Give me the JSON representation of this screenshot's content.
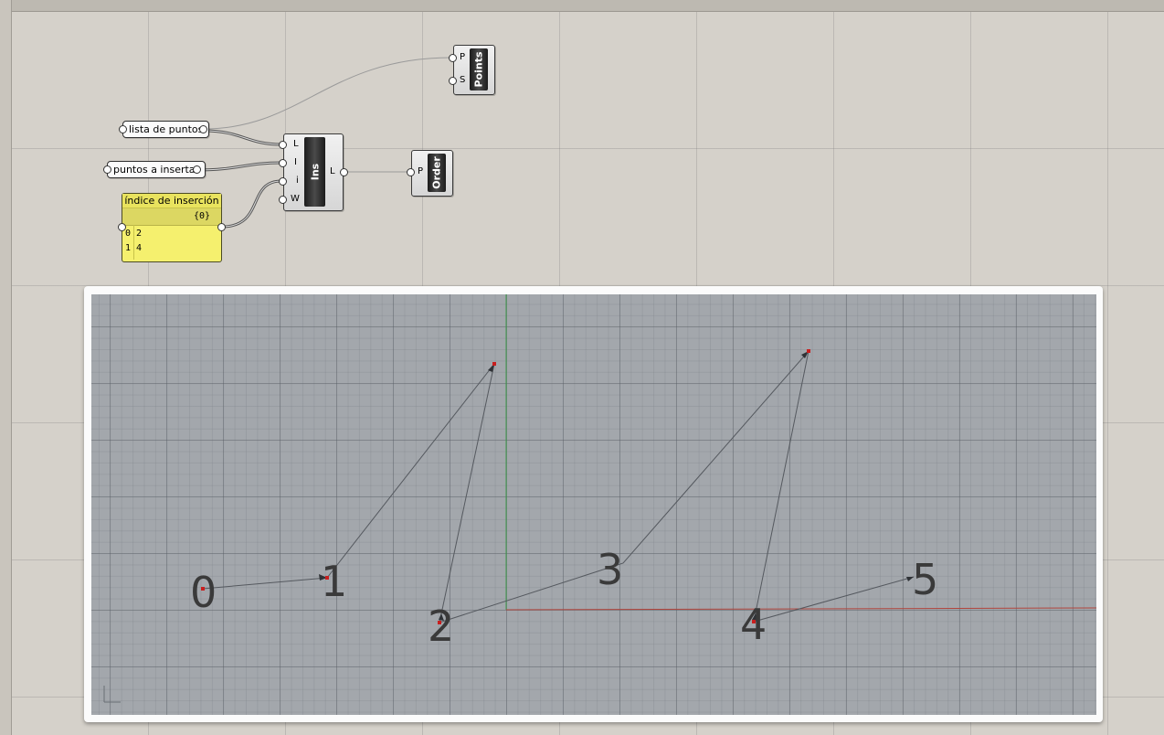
{
  "canvas": {
    "inputs": {
      "lista_de_puntos": "lista de puntos",
      "puntos_a_insertar": "puntos a insertar"
    },
    "panel": {
      "title": "índice de inserción",
      "branch": "{0}",
      "rows": [
        {
          "index": "0",
          "value": "2"
        },
        {
          "index": "1",
          "value": "4"
        }
      ]
    },
    "insert_component": {
      "name": "Ins",
      "inputs": [
        "L",
        "I",
        "i",
        "W"
      ],
      "output": "L"
    },
    "points_component": {
      "name": "Points",
      "inputs": [
        "P",
        "S"
      ]
    },
    "order_component": {
      "name": "Order",
      "inputs": [
        "P"
      ]
    }
  },
  "viewport": {
    "point_labels": [
      "0",
      "1",
      "2",
      "3",
      "4",
      "5"
    ],
    "axis_colors": {
      "x": "#b0443c",
      "y": "#3c9a4a"
    },
    "curve_color": "#555a60",
    "point_color": "#c81e1e"
  }
}
